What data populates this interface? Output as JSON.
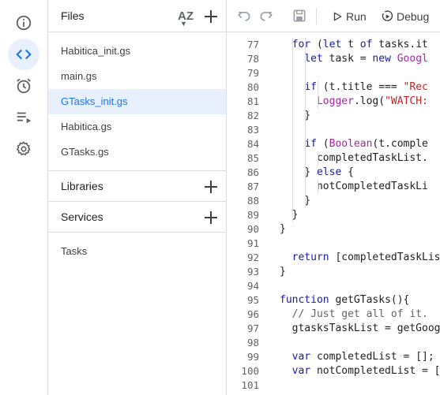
{
  "left_rail": {
    "icons": [
      "info-icon",
      "code-icon",
      "alarm-clock-icon",
      "executions-icon",
      "gear-icon"
    ],
    "active": "code-icon"
  },
  "files_panel": {
    "title": "Files",
    "sort_label": "AZ",
    "files": [
      "Habitica_init.gs",
      "main.gs",
      "GTasks_init.gs",
      "Habitica.gs",
      "GTasks.gs"
    ],
    "selected_file": "GTasks_init.gs",
    "sections": [
      {
        "label": "Libraries"
      },
      {
        "label": "Services"
      }
    ],
    "services_items": [
      "Tasks"
    ]
  },
  "toolbar": {
    "run_label": "Run",
    "debug_label": "Debug"
  },
  "editor": {
    "lines": [
      {
        "n": "77",
        "t": "  for (let t of tasks.it"
      },
      {
        "n": "78",
        "t": "    let task = new Googl"
      },
      {
        "n": "79",
        "t": ""
      },
      {
        "n": "80",
        "t": "    if (t.title === \"Rec"
      },
      {
        "n": "81",
        "t": "      Logger.log(\"WATCH:"
      },
      {
        "n": "82",
        "t": "    }"
      },
      {
        "n": "83",
        "t": ""
      },
      {
        "n": "84",
        "t": "    if (Boolean(t.comple"
      },
      {
        "n": "85",
        "t": "      completedTaskList."
      },
      {
        "n": "86",
        "t": "    } else {"
      },
      {
        "n": "87",
        "t": "      notCompletedTaskLi"
      },
      {
        "n": "88",
        "t": "    }"
      },
      {
        "n": "89",
        "t": "  }"
      },
      {
        "n": "90",
        "t": "}"
      },
      {
        "n": "91",
        "t": ""
      },
      {
        "n": "92",
        "t": "  return [completedTaskLis"
      },
      {
        "n": "93",
        "t": "}"
      },
      {
        "n": "94",
        "t": ""
      },
      {
        "n": "95",
        "t": "function getGTasks(){"
      },
      {
        "n": "96",
        "t": "  // Just get all of it."
      },
      {
        "n": "97",
        "t": "  gtasksTaskList = getGoog"
      },
      {
        "n": "98",
        "t": ""
      },
      {
        "n": "99",
        "t": "  var completedList = [];"
      },
      {
        "n": "100",
        "t": "  var notCompletedList = ["
      },
      {
        "n": "101",
        "t": ""
      }
    ],
    "accent_color": "#1a73e8",
    "selected_bg": "#e8f0fe"
  }
}
